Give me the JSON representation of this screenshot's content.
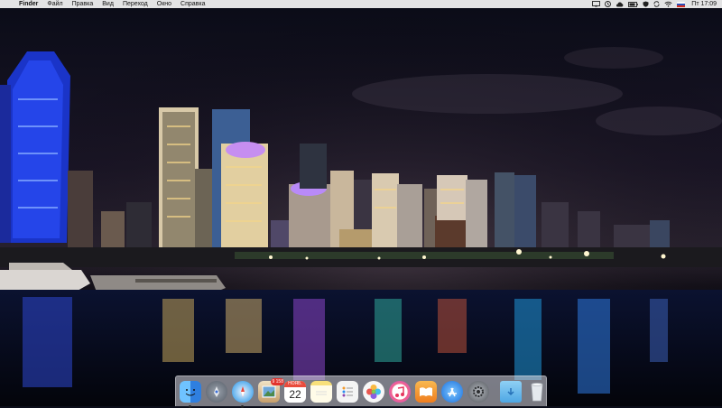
{
  "menubar": {
    "apple_icon": "",
    "app_name": "Finder",
    "items": [
      "Файл",
      "Правка",
      "Вид",
      "Переход",
      "Окно",
      "Справка"
    ],
    "tray_icons": [
      "airplay-icon",
      "time-machine-icon",
      "cloud-icon",
      "battery-icon",
      "vpn-icon",
      "sync-icon",
      "wifi-icon",
      "flag-icon"
    ],
    "clock": "Пт 17:09"
  },
  "dock": {
    "apps": [
      {
        "name": "finder-icon",
        "color": "#2f7fe0",
        "running": true
      },
      {
        "name": "launchpad-icon",
        "color": "#6f7682",
        "running": false
      },
      {
        "name": "safari-icon",
        "color": "#1b8fe6",
        "running": true
      },
      {
        "name": "photos-preview-icon",
        "color": "#d9b078",
        "running": false,
        "badge": "9 158"
      },
      {
        "name": "calendar-icon",
        "color": "#ffffff",
        "running": false,
        "cal_month": "НОЯБ.",
        "cal_day": "22"
      },
      {
        "name": "notes-icon",
        "color": "#f6df6d",
        "running": false
      },
      {
        "name": "reminders-icon",
        "color": "#f0f0f0",
        "running": false
      },
      {
        "name": "photos-icon",
        "color": "#f0f0f0",
        "running": false
      },
      {
        "name": "itunes-icon",
        "color": "#ef3d6a",
        "running": false
      },
      {
        "name": "ibooks-icon",
        "color": "#f29a2e",
        "running": false
      },
      {
        "name": "app-store-icon",
        "color": "#2a8df0",
        "running": false
      },
      {
        "name": "system-preferences-icon",
        "color": "#6f7177",
        "running": false
      }
    ],
    "extras": [
      {
        "name": "downloads-folder-icon",
        "color": "#5fb5ea"
      },
      {
        "name": "trash-icon",
        "color": "#dfe4ea"
      }
    ]
  }
}
